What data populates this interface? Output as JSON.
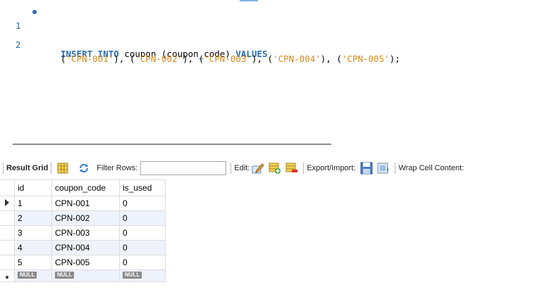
{
  "editor": {
    "lines": [
      {
        "number": "1",
        "tokens": {
          "kw_insert": "INSERT INTO",
          "table": " coupon ",
          "cols": "(coupon_code) ",
          "kw_values": "VALUES"
        }
      },
      {
        "number": "2",
        "tokens": {
          "p1": "(",
          "s1": "'CPN-001'",
          "p2": "), (",
          "s2": "'CPN-002'",
          "p3": "), (",
          "s3": "'CPN-003'",
          "p4": "), (",
          "s4": "'CPN-004'",
          "p5": "), (",
          "s5": "'CPN-005'",
          "p6": ");"
        }
      }
    ]
  },
  "toolbar": {
    "result_grid": "Result Grid",
    "filter_rows": "Filter Rows:",
    "filter_value": "",
    "edit": "Edit:",
    "export_import": "Export/Import:",
    "wrap": "Wrap Cell Content:"
  },
  "grid": {
    "columns": [
      "id",
      "coupon_code",
      "is_used"
    ],
    "rows": [
      [
        "1",
        "CPN-001",
        "0"
      ],
      [
        "2",
        "CPN-002",
        "0"
      ],
      [
        "3",
        "CPN-003",
        "0"
      ],
      [
        "4",
        "CPN-004",
        "0"
      ],
      [
        "5",
        "CPN-005",
        "0"
      ]
    ],
    "null_label": "NULL"
  },
  "colors": {
    "keyword": "#2b6db3",
    "string": "#d58a1e",
    "line_number": "#2d6aa8",
    "alt_row": "#eef3fb"
  },
  "icons": [
    "row-indicator-arrow-icon",
    "form-view-icon",
    "refresh-icon",
    "edit-pencil-icon",
    "insert-row-icon",
    "delete-row-icon",
    "export-icon",
    "import-icon"
  ]
}
